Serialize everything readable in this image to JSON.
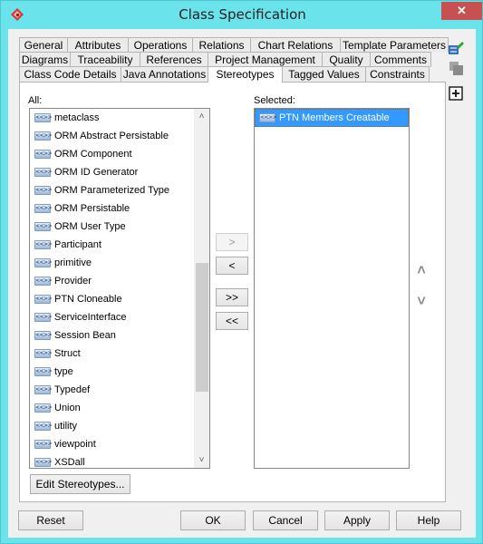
{
  "window": {
    "title": "Class Specification",
    "app_icon": "visual-paradigm-logo-icon",
    "close_label": "✕"
  },
  "tabs": {
    "row1": [
      {
        "label": "General"
      },
      {
        "label": "Attributes"
      },
      {
        "label": "Operations"
      },
      {
        "label": "Relations"
      },
      {
        "label": "Chart Relations"
      },
      {
        "label": "Template Parameters"
      }
    ],
    "row2": [
      {
        "label": "Diagrams"
      },
      {
        "label": "Traceability"
      },
      {
        "label": "References"
      },
      {
        "label": "Project Management"
      },
      {
        "label": "Quality"
      },
      {
        "label": "Comments"
      }
    ],
    "row3": [
      {
        "label": "Class Code Details"
      },
      {
        "label": "Java Annotations"
      },
      {
        "label": "Stereotypes",
        "active": true
      },
      {
        "label": "Tagged Values"
      },
      {
        "label": "Constraints"
      }
    ]
  },
  "side_tools": [
    {
      "icon": "edit-diagram-icon"
    },
    {
      "icon": "layers-icon"
    },
    {
      "icon": "expand-icon",
      "glyph": "+"
    }
  ],
  "stereotypes": {
    "all_label": "All:",
    "selected_label": "Selected:",
    "icon_text": "<<>>",
    "all_items": [
      "metaclass",
      "ORM Abstract Persistable",
      "ORM Component",
      "ORM ID Generator",
      "ORM Parameterized Type",
      "ORM Persistable",
      "ORM User Type",
      "Participant",
      "primitive",
      "Provider",
      "PTN Cloneable",
      "ServiceInterface",
      "Session Bean",
      "Struct",
      "type",
      "Typedef",
      "Union",
      "utility",
      "viewpoint",
      "XSDall"
    ],
    "selected_items": [
      {
        "label": "PTN Members Creatable",
        "selected": true
      }
    ],
    "scroll_up_glyph": "˄",
    "scroll_down_glyph": "˅",
    "move_buttons": {
      "add": ">",
      "remove": "<",
      "add_all": ">>",
      "remove_all": "<<"
    },
    "order_up_glyph": "˄",
    "order_down_glyph": "˅",
    "edit_button": "Edit Stereotypes..."
  },
  "footer": {
    "reset": "Reset",
    "ok": "OK",
    "cancel": "Cancel",
    "apply": "Apply",
    "help": "Help"
  }
}
